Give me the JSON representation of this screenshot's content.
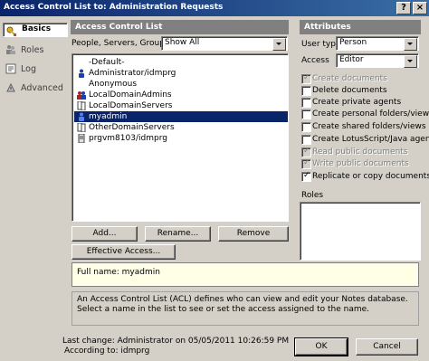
{
  "window": {
    "title": "Access Control List to: Administration Requests",
    "controls": [
      "?",
      "×"
    ]
  },
  "sidebar": {
    "tabs": [
      {
        "label": "Basics",
        "icon": "key-icon",
        "selected": true
      },
      {
        "label": "Roles",
        "icon": "roles-icon",
        "selected": false
      },
      {
        "label": "Log",
        "icon": "log-icon",
        "selected": false
      },
      {
        "label": "Advanced",
        "icon": "advanced-icon",
        "selected": false
      }
    ]
  },
  "acl": {
    "header": "Access Control List",
    "filter_label": "People, Servers, Groups",
    "filter_value": "Show All",
    "entries": [
      {
        "name": "-Default-",
        "icon": "none",
        "selected": false
      },
      {
        "name": "Administrator/idmprg",
        "icon": "person-icon",
        "selected": false
      },
      {
        "name": "Anonymous",
        "icon": "none",
        "selected": false
      },
      {
        "name": "LocalDomainAdmins",
        "icon": "group-icon",
        "selected": false
      },
      {
        "name": "LocalDomainServers",
        "icon": "server-group-icon",
        "selected": false
      },
      {
        "name": "myadmin",
        "icon": "person-icon",
        "selected": true
      },
      {
        "name": "OtherDomainServers",
        "icon": "server-group-icon",
        "selected": false
      },
      {
        "name": "prgvm8103/idmprg",
        "icon": "server-icon",
        "selected": false
      }
    ],
    "buttons": {
      "add": "Add...",
      "rename": "Rename...",
      "remove": "Remove"
    },
    "effective_access": "Effective Access...",
    "full_name": "Full name: myadmin",
    "description": "An Access Control List (ACL) defines who can view and edit your Notes database.  Select a name in the list to see or set the access assigned to the name."
  },
  "attributes": {
    "header": "Attributes",
    "user_type_label": "User type",
    "user_type_value": "Person",
    "access_label": "Access",
    "access_value": "Editor",
    "checkboxes": [
      {
        "label": "Create documents",
        "checked": true,
        "disabled": true
      },
      {
        "label": "Delete documents",
        "checked": false,
        "disabled": false
      },
      {
        "label": "Create private agents",
        "checked": false,
        "disabled": false
      },
      {
        "label": "Create personal folders/views",
        "checked": false,
        "disabled": false
      },
      {
        "label": "Create shared folders/views",
        "checked": false,
        "disabled": false
      },
      {
        "label": "Create LotusScript/Java agents",
        "checked": false,
        "disabled": false
      },
      {
        "label": "Read public documents",
        "checked": true,
        "disabled": true
      },
      {
        "label": "Write public documents",
        "checked": true,
        "disabled": true
      },
      {
        "label": "Replicate or copy documents",
        "checked": true,
        "disabled": false
      }
    ],
    "roles_label": "Roles"
  },
  "footer": {
    "last_change": "Last change: Administrator on 05/05/2011 10:26:59 PM",
    "according_to": "According to: idmprg",
    "ok": "OK",
    "cancel": "Cancel"
  }
}
